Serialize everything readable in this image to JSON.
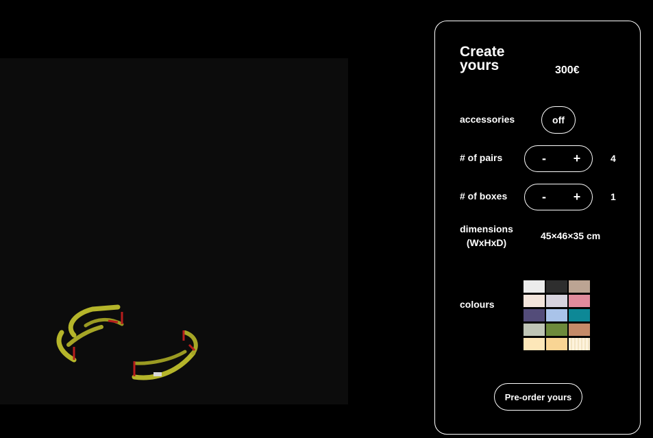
{
  "panel": {
    "title": "Create yours",
    "price": "300€",
    "accessories_label": "accessories",
    "accessories_value": "off",
    "pairs_label": "# of pairs",
    "pairs_count": "4",
    "boxes_label": "# of boxes",
    "boxes_count": "1",
    "minus_label": "-",
    "plus_label": "+",
    "dimensions_label": "dimensions (WxHxD)",
    "dimensions_value": "45×46×35 cm",
    "colours_label": "colours",
    "colours": [
      "#ececec",
      "#2e2e2e",
      "#bca493",
      "#f3e5dc",
      "#d7d3de",
      "#e08b9c",
      "#534c79",
      "#a9c3e9",
      "#0d8896",
      "#bfc5b6",
      "#6d8a3c",
      "#c48a68",
      "#fde7b9",
      "#f9d594",
      "#fcf1dd"
    ],
    "cta_label": "Pre-order yours"
  },
  "model_colors": {
    "frame": "#b5b52a",
    "accent": "#b71d1d"
  }
}
